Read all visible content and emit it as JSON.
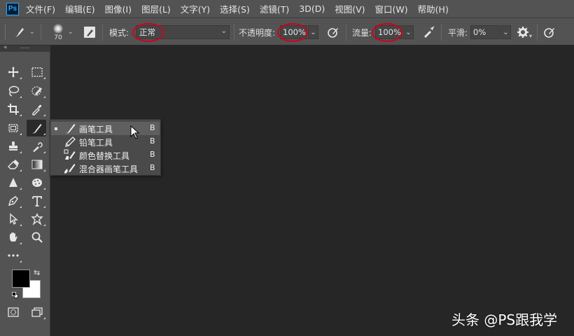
{
  "app": {
    "logo_text": "Ps"
  },
  "menu": [
    "文件(F)",
    "编辑(E)",
    "图像(I)",
    "图层(L)",
    "文字(Y)",
    "选择(S)",
    "滤镜(T)",
    "3D(D)",
    "视图(V)",
    "窗口(W)",
    "帮助(H)"
  ],
  "options": {
    "brush_size": "70",
    "mode_label": "模式:",
    "mode_value": "正常",
    "opacity_label": "不透明度:",
    "opacity_value": "100%",
    "flow_label": "流量:",
    "flow_value": "100%",
    "smoothing_label": "平滑:",
    "smoothing_value": "0%"
  },
  "flyout": {
    "items": [
      {
        "label": "画笔工具",
        "key": "B",
        "icon": "brush-icon",
        "selected": true
      },
      {
        "label": "铅笔工具",
        "key": "B",
        "icon": "pencil-icon",
        "selected": false
      },
      {
        "label": "颜色替换工具",
        "key": "B",
        "icon": "color-replacement-icon",
        "selected": false
      },
      {
        "label": "混合器画笔工具",
        "key": "B",
        "icon": "mixer-brush-icon",
        "selected": false
      }
    ]
  },
  "colors": {
    "foreground": "#000000",
    "background": "#ffffff",
    "highlight_circle": "#d0021b"
  },
  "watermark": "头条 @PS跟我学"
}
